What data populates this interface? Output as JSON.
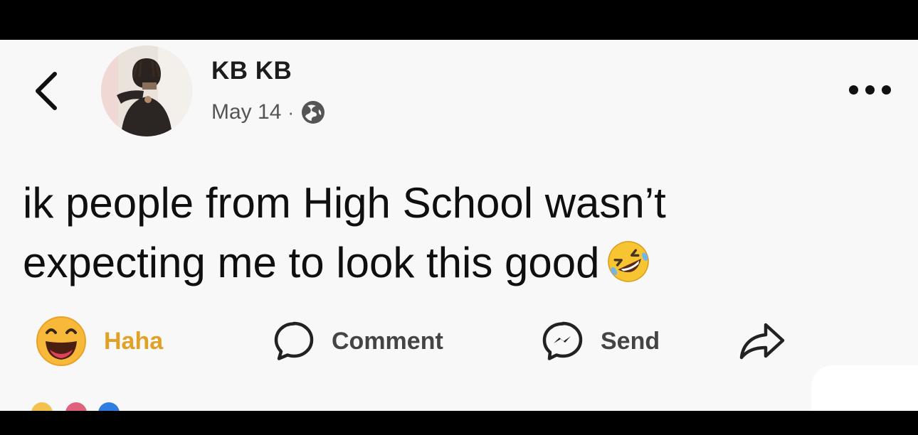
{
  "post": {
    "author": "KB KB",
    "date": "May 14",
    "separator": "·",
    "privacy_icon": "globe-icon",
    "text_line1": "ik people from High School wasn’t",
    "text_line2": "expecting me to look this good",
    "text_emoji": "rolling-on-floor-laughing-emoji"
  },
  "actions": {
    "haha_label": "Haha",
    "comment_label": "Comment",
    "send_label": "Send"
  },
  "colors": {
    "haha_accent": "#e0a126",
    "background": "#f8f8f8",
    "frame": "#000000"
  }
}
